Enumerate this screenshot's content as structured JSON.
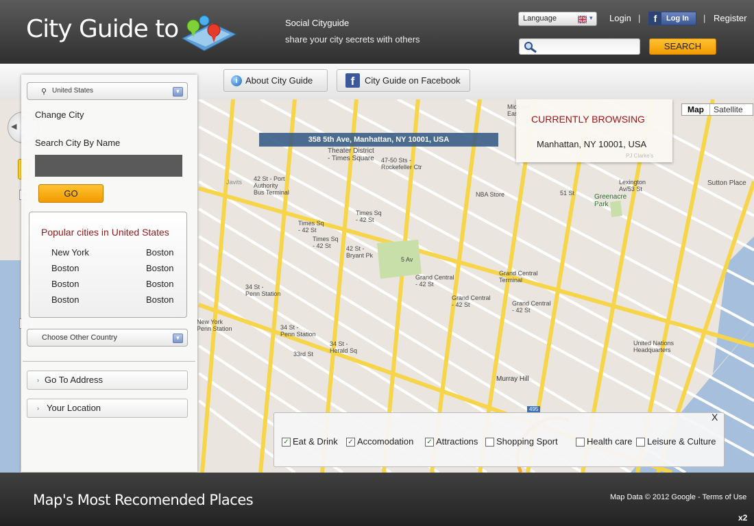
{
  "header": {
    "logo_text": "City Guide to",
    "tagline_title": "Social Cityguide",
    "tagline_sub": "share your city secrets with others",
    "language_label": "Language",
    "login_label": "Login",
    "fb_login_label": "Log In",
    "register_label": "Register",
    "search_placeholder": "",
    "search_button": "SEARCH"
  },
  "toolbar": {
    "about_label": "About City Guide",
    "facebook_label": "City Guide on Facebook"
  },
  "sidebar": {
    "country_select": "United States",
    "change_city_label": "Change  City",
    "search_city_label": "Search City  By Name",
    "city_input_value": "",
    "go_button": "GO",
    "popular_title": "Popular cities in United States",
    "popular_cities": [
      [
        "New York",
        "Boston"
      ],
      [
        "Boston",
        "Boston"
      ],
      [
        "Boston",
        "Boston"
      ],
      [
        "Boston",
        "Boston"
      ]
    ],
    "other_country_select": "Choose Other Country",
    "go_to_address": "Go To Address",
    "your_location": "Your Location"
  },
  "map": {
    "address_banner": "358 5th Ave, Manhattan, NY 10001, USA",
    "browsing_title": "CURRENTLY BROWSING",
    "browsing_value": "Manhattan, NY 10001, USA",
    "map_type_map": "Map",
    "map_type_satellite": "Satellite",
    "labels": {
      "theater": "Theater District\n- Times Square",
      "rockefeller": "47-50 Sts -\nRockefeller Ctr",
      "port": "42 St - Port\nAuthority\nBus Terminal",
      "nba": "NBA Store",
      "st51": "51 St",
      "lexington": "Lexington\nAv/53 St",
      "greenacre": "Greenacre\nPark",
      "sutton": "Sutton Place",
      "timessq1": "Times Sq\n- 42 St",
      "timessq2": "Times Sq\n- 42 St",
      "timessq3": "Times Sq\n- 42 St",
      "bryant": "42 St -\nBryant Pk",
      "fifthav": "5 Av",
      "gc1": "Grand Central\n- 42 St",
      "gc2": "Grand Central\nTerminal",
      "gc3": "Grand Central\n- 42 St",
      "gc4": "Grand Central\n- 42 St",
      "penn1": "34 St -\nPenn Station",
      "penn2": "New York\nPenn Station",
      "penn3": "34 St -\nPenn Station",
      "herald": "34 St -\nHerald Sq",
      "st33": "33rd St",
      "murray": "Murray Hill",
      "un": "United Nations\nHeadquarters",
      "midtown": "Midtown\nEast",
      "pj": "PJ Clarke's",
      "javits": "Javits",
      "w495": "495"
    }
  },
  "filters": {
    "close_label": "X",
    "items": [
      {
        "label": "Eat & Drink",
        "checked": true
      },
      {
        "label": "Accomodation",
        "checked": true
      },
      {
        "label": "Attractions",
        "checked": true
      },
      {
        "label": "Shopping  Sport",
        "checked": false
      },
      {
        "label": "Health care",
        "checked": false
      },
      {
        "label": "Leisure & Culture",
        "checked": false
      }
    ]
  },
  "footer": {
    "title": "Map's Most Recomended Places",
    "copyright": "Map Data © 2012 Google - Terms of Use",
    "zoom": "x2"
  },
  "colors": {
    "accent_orange": "#f7a50a",
    "browse_red": "#a31212",
    "popular_red": "#8b1a1a",
    "banner_blue": "#345a85"
  },
  "icons": [
    "magnifier-icon",
    "uk-flag-icon",
    "facebook-icon",
    "info-globe-icon",
    "pegman-icon",
    "chevron-down-icon",
    "checkbox-icon"
  ]
}
